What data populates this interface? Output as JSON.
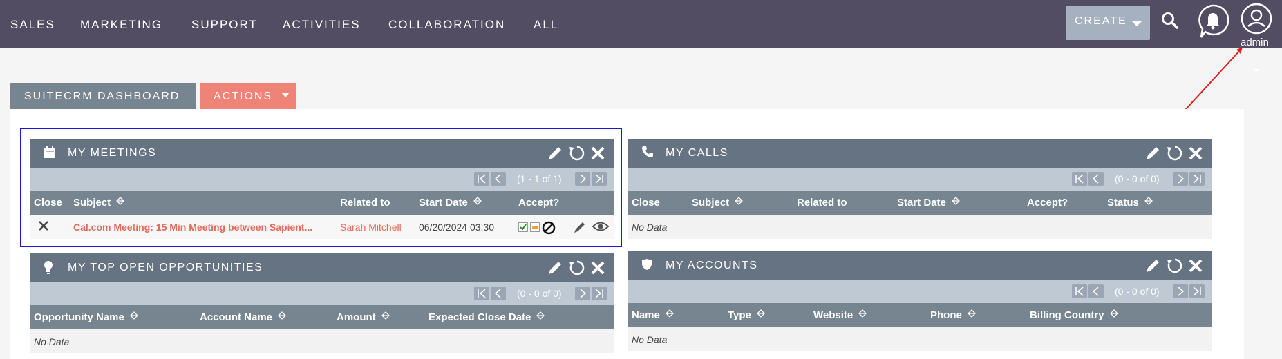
{
  "nav": {
    "items": [
      "SALES",
      "MARKETING",
      "SUPPORT",
      "ACTIVITIES",
      "COLLABORATION",
      "ALL"
    ],
    "create_label": "CREATE",
    "user_label": "admin"
  },
  "dashboard": {
    "tab_label": "SUITECRM DASHBOARD",
    "actions_label": "ACTIONS"
  },
  "meetings": {
    "title": "MY MEETINGS",
    "pager": "(1 - 1 of 1)",
    "columns": [
      "Close",
      "Subject",
      "Related to",
      "Start Date",
      "Accept?"
    ],
    "row": {
      "subject": "Cal.com Meeting: 15 Min Meeting between Sapient...",
      "related_to": "Sarah Mitchell",
      "start_date": "06/20/2024 03:30"
    }
  },
  "calls": {
    "title": "MY CALLS",
    "pager": "(0 - 0 of 0)",
    "columns": [
      "Close",
      "Subject",
      "Related to",
      "Start Date",
      "Accept?",
      "Status"
    ],
    "empty": "No Data"
  },
  "opportunities": {
    "title": "MY TOP OPEN OPPORTUNITIES",
    "pager": "(0 - 0 of 0)",
    "columns": [
      "Opportunity Name",
      "Account Name",
      "Amount",
      "Expected Close Date"
    ],
    "empty": "No Data"
  },
  "accounts": {
    "title": "MY ACCOUNTS",
    "pager": "(0 - 0 of 0)",
    "columns": [
      "Name",
      "Type",
      "Website",
      "Phone",
      "Billing Country"
    ],
    "empty": "No Data"
  },
  "colors": {
    "topbar": "#534d64",
    "dashlet_header": "#667382",
    "accent": "#f08377",
    "link": "#e2695c",
    "highlight": "#1a1ad6"
  }
}
